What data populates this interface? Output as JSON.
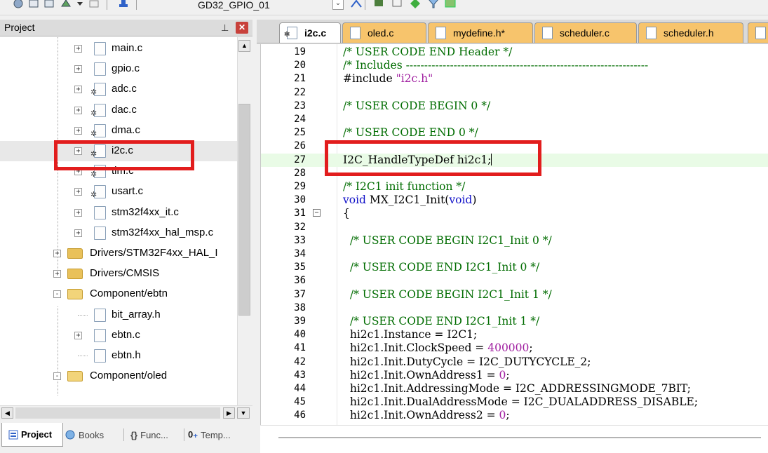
{
  "toolbar": {
    "target": "GD32_GPIO_01"
  },
  "project_panel": {
    "title": "Project",
    "tree": [
      {
        "label": "main.c",
        "indent": 2,
        "kind": "file",
        "expander": "+",
        "gear": false
      },
      {
        "label": "gpio.c",
        "indent": 2,
        "kind": "file",
        "expander": "+",
        "gear": false
      },
      {
        "label": "adc.c",
        "indent": 2,
        "kind": "file",
        "expander": "+",
        "gear": true
      },
      {
        "label": "dac.c",
        "indent": 2,
        "kind": "file",
        "expander": "+",
        "gear": true
      },
      {
        "label": "dma.c",
        "indent": 2,
        "kind": "file",
        "expander": "+",
        "gear": true
      },
      {
        "label": "i2c.c",
        "indent": 2,
        "kind": "file",
        "expander": "+",
        "gear": true,
        "selected": true
      },
      {
        "label": "tim.c",
        "indent": 2,
        "kind": "file",
        "expander": "+",
        "gear": true
      },
      {
        "label": "usart.c",
        "indent": 2,
        "kind": "file",
        "expander": "+",
        "gear": true
      },
      {
        "label": "stm32f4xx_it.c",
        "indent": 2,
        "kind": "file",
        "expander": "+",
        "gear": false
      },
      {
        "label": "stm32f4xx_hal_msp.c",
        "indent": 2,
        "kind": "file",
        "expander": "+",
        "gear": false
      },
      {
        "label": "Drivers/STM32F4xx_HAL_I",
        "indent": 1,
        "kind": "folder",
        "expander": "+"
      },
      {
        "label": "Drivers/CMSIS",
        "indent": 1,
        "kind": "folder",
        "expander": "+"
      },
      {
        "label": "Component/ebtn",
        "indent": 1,
        "kind": "folder-open",
        "expander": "-"
      },
      {
        "label": "bit_array.h",
        "indent": 2,
        "kind": "file",
        "expander": "",
        "gear": false
      },
      {
        "label": "ebtn.c",
        "indent": 2,
        "kind": "file",
        "expander": "+",
        "gear": false
      },
      {
        "label": "ebtn.h",
        "indent": 2,
        "kind": "file",
        "expander": "",
        "gear": false
      },
      {
        "label": "Component/oled",
        "indent": 1,
        "kind": "folder-open",
        "expander": "-"
      }
    ],
    "bottom_tabs": [
      {
        "label": "Project",
        "active": true
      },
      {
        "label": "Books",
        "active": false
      },
      {
        "label": "Func...",
        "active": false
      },
      {
        "label": "Temp...",
        "active": false
      }
    ]
  },
  "editor": {
    "tabs": [
      {
        "label": "i2c.c",
        "active": true
      },
      {
        "label": "oled.c",
        "active": false
      },
      {
        "label": "mydefine.h*",
        "active": false
      },
      {
        "label": "scheduler.c",
        "active": false
      },
      {
        "label": "scheduler.h",
        "active": false
      }
    ],
    "lines": [
      {
        "n": "19",
        "t": "/* USER CODE END Header */"
      },
      {
        "n": "20",
        "t": "/* Includes ------------------------------------------------------------------"
      },
      {
        "n": "21",
        "t": "#include \"i2c.h\""
      },
      {
        "n": "22",
        "t": ""
      },
      {
        "n": "23",
        "t": "/* USER CODE BEGIN 0 */"
      },
      {
        "n": "24",
        "t": ""
      },
      {
        "n": "25",
        "t": "/* USER CODE END 0 */"
      },
      {
        "n": "26",
        "t": ""
      },
      {
        "n": "27",
        "t": "I2C_HandleTypeDef hi2c1;"
      },
      {
        "n": "28",
        "t": ""
      },
      {
        "n": "29",
        "t": "/* I2C1 init function */"
      },
      {
        "n": "30",
        "t": "void MX_I2C1_Init(void)"
      },
      {
        "n": "31",
        "t": "{"
      },
      {
        "n": "32",
        "t": ""
      },
      {
        "n": "33",
        "t": "  /* USER CODE BEGIN I2C1_Init 0 */"
      },
      {
        "n": "34",
        "t": ""
      },
      {
        "n": "35",
        "t": "  /* USER CODE END I2C1_Init 0 */"
      },
      {
        "n": "36",
        "t": ""
      },
      {
        "n": "37",
        "t": "  /* USER CODE BEGIN I2C1_Init 1 */"
      },
      {
        "n": "38",
        "t": ""
      },
      {
        "n": "39",
        "t": "  /* USER CODE END I2C1_Init 1 */"
      },
      {
        "n": "40",
        "t": "  hi2c1.Instance = I2C1;"
      },
      {
        "n": "41",
        "t": "  hi2c1.Init.ClockSpeed = 400000;"
      },
      {
        "n": "42",
        "t": "  hi2c1.Init.DutyCycle = I2C_DUTYCYCLE_2;"
      },
      {
        "n": "43",
        "t": "  hi2c1.Init.OwnAddress1 = 0;"
      },
      {
        "n": "44",
        "t": "  hi2c1.Init.AddressingMode = I2C_ADDRESSINGMODE_7BIT;"
      },
      {
        "n": "45",
        "t": "  hi2c1.Init.DualAddressMode = I2C_DUALADDRESS_DISABLE;"
      },
      {
        "n": "46",
        "t": "  hi2c1.Init.OwnAddress2 = 0;"
      }
    ]
  },
  "colors": {
    "highlight_box": "#e21d1d",
    "current_line": "#e9fbe6",
    "comment": "#006c00",
    "keyword": "#1010c8",
    "string": "#a01ea0"
  }
}
